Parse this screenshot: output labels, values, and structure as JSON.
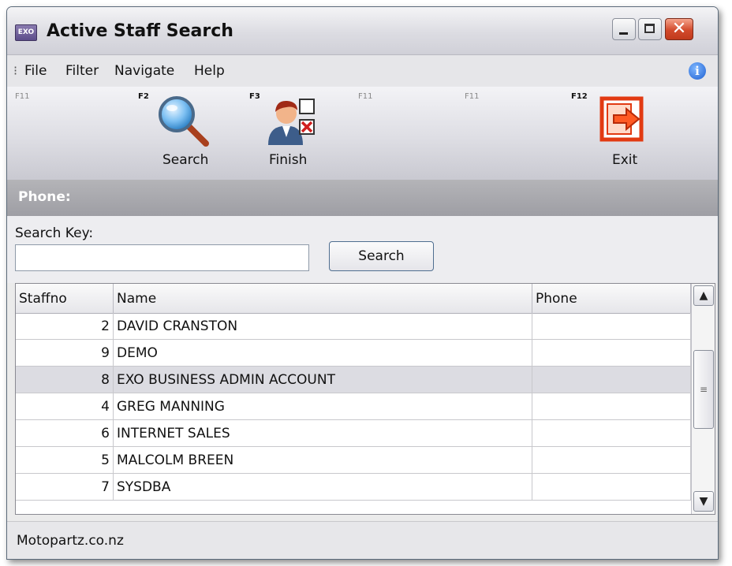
{
  "window": {
    "title": "Active Staff Search",
    "app_icon_text": "EXO",
    "minimize_icon": "minimize-icon",
    "maximize_icon": "maximize-icon",
    "close_icon": "close-icon"
  },
  "menu": {
    "items": [
      "File",
      "Filter",
      "Navigate",
      "Help"
    ],
    "info_icon": "info-icon"
  },
  "toolbar": {
    "buttons": [
      {
        "key": "F11",
        "label": ""
      },
      {
        "key": "F2",
        "label": "Search",
        "icon": "magnifier-icon"
      },
      {
        "key": "F3",
        "label": "Finish",
        "icon": "user-finish-icon"
      },
      {
        "key": "F11",
        "label": ""
      },
      {
        "key": "F11",
        "label": ""
      },
      {
        "key": "F12",
        "label": "Exit",
        "icon": "exit-door-icon"
      }
    ]
  },
  "section": {
    "header": "Phone:"
  },
  "search": {
    "label": "Search Key:",
    "value": "",
    "button_label": "Search"
  },
  "table": {
    "columns": [
      "Staffno",
      "Name",
      "Phone"
    ],
    "rows": [
      {
        "staffno": "2",
        "name": "DAVID CRANSTON",
        "phone": ""
      },
      {
        "staffno": "9",
        "name": "DEMO",
        "phone": ""
      },
      {
        "staffno": "8",
        "name": "EXO BUSINESS ADMIN ACCOUNT",
        "phone": "",
        "selected": true
      },
      {
        "staffno": "4",
        "name": "GREG MANNING",
        "phone": ""
      },
      {
        "staffno": "6",
        "name": "INTERNET SALES",
        "phone": ""
      },
      {
        "staffno": "5",
        "name": "MALCOLM BREEN",
        "phone": ""
      },
      {
        "staffno": "7",
        "name": "SYSDBA",
        "phone": ""
      }
    ]
  },
  "status": {
    "text": "Motopartz.co.nz"
  },
  "colors": {
    "selected_row": "#dcdce2",
    "section_header": "#a8a8ae",
    "close_button": "#d24a2c"
  }
}
